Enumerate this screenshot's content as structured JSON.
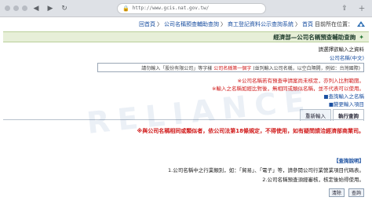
{
  "browser": {
    "url": "http://www.gcis.nat.gov.tw/",
    "lock": "🔒"
  },
  "header": {
    "site_title": "目前所在位置：",
    "home_link": "首頁",
    "crumb_separator": "〉",
    "crumb_1": "商工登記資料公示查詢系統",
    "crumb_2": "公司名稱預查輔助查詢",
    "tail": "回首頁"
  },
  "page_title": "經濟部—公司名稱預查輔助查詢",
  "lines": {
    "l1": "請選擇欲輸入之資料",
    "l2": "公司名稱(中文)",
    "search_hint": "(並列輸入公司名稱，以空白隔開，例如：台灣國際)",
    "search_red": "公司名稱第一個字",
    "search_tail": "請勿輸入「股份有限公司」等字樣",
    "note1": "※公司名稱若有預查申請案尚未核定，亦列入比對範圍。",
    "note2": "※輸入之名稱如經比對後，無相同或類似名稱，並不代表可以使用。",
    "link1": "■查詢輸入之名稱",
    "link2": "■變更輸入項目"
  },
  "tabs": {
    "t1": "執行查詢",
    "t2": "重新輸入"
  },
  "warning": "※與公司名稱相同或類似者，依公司法第18條規定，不得使用，如有疑問請洽經濟部商業司。",
  "section_label": "【查詢說明】",
  "instr1": "1.公司名稱中之行業類別，如：「貿易」、「電子」等，請參閱公司行業營業項目代碼表。",
  "instr2": "2.公司名稱預查須經審核，核定後始得使用。",
  "buttons": {
    "query": "查詢",
    "clear": "清除"
  },
  "watermark": "RELIANCE"
}
